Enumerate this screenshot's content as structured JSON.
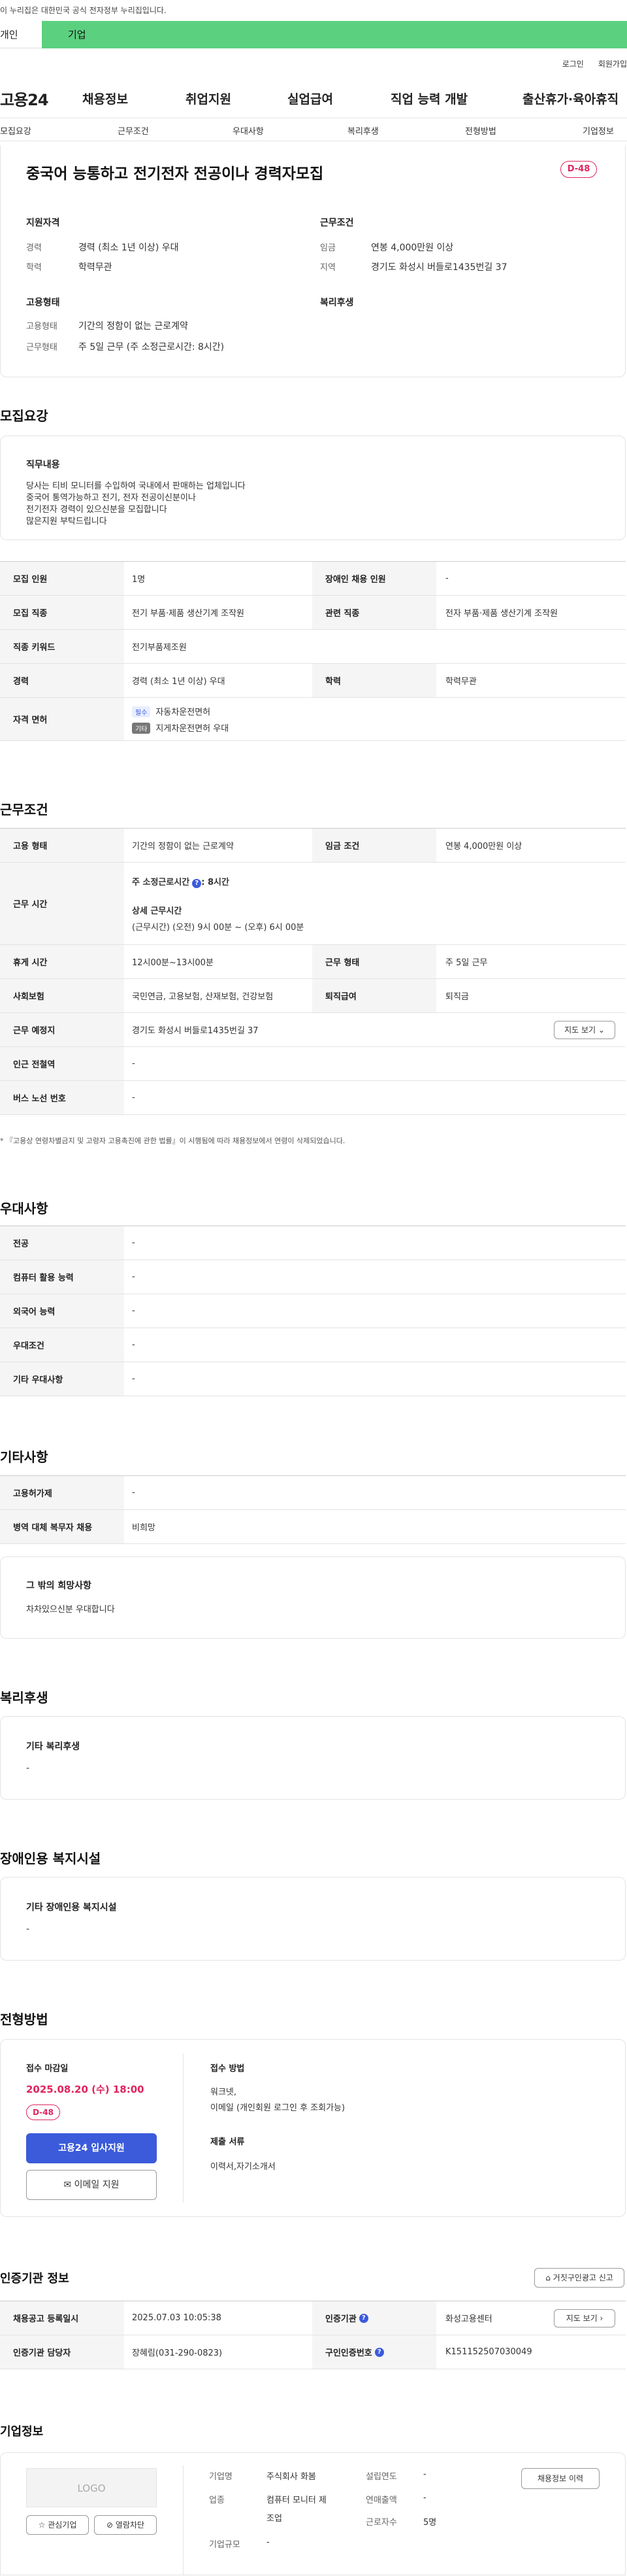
{
  "banner": {
    "text": "이 누리집은 대한민국 공식 전자정부 누리집입니다."
  },
  "tabs": {
    "personal": "개인",
    "company": "기업"
  },
  "util": {
    "login": "로그인",
    "signup": "회원가입"
  },
  "gnb": {
    "logo": "고용24",
    "items": [
      "채용정보",
      "취업지원",
      "실업급여",
      "직업 능력 개발",
      "출산휴가·육아휴직"
    ]
  },
  "subnav": [
    "모집요강",
    "근무조건",
    "우대사항",
    "복리후생",
    "전형방법",
    "기업정보"
  ],
  "summary": {
    "title": "중국어 능통하고 전기전자 전공이나 경력자모집",
    "dday": "D-48",
    "qual": {
      "heading": "지원자격",
      "career_k": "경력",
      "career_v": "경력 (최소 1년 이상) 우대",
      "edu_k": "학력",
      "edu_v": "학력무관"
    },
    "cond": {
      "heading": "근무조건",
      "wage_k": "임금",
      "wage_v": "연봉 4,000만원 이상",
      "loc_k": "지역",
      "loc_v": "경기도 화성시 버들로1435번길 37"
    },
    "emp": {
      "heading": "고용형태",
      "type_k": "고용형태",
      "type_v": "기간의 정함이 없는 근로계약",
      "work_k": "근무형태",
      "work_v": "주 5일 근무 (주 소정근로시간: 8시간)"
    },
    "welfare": {
      "heading": "복리후생"
    }
  },
  "recruit": {
    "title": "모집요강",
    "job_heading": "직무내용",
    "job_lines": [
      "당사는 티비 모니터를 수입하여 국내에서 판매하는 업체입니다",
      "중국어 통역가능하고 전기, 전자 전공이신분이나",
      "전기전자 경력이 있으신분을 모집합니다",
      "많은지원 부탁드립니다"
    ],
    "rows": [
      {
        "k1": "모집 인원",
        "v1": "1명",
        "k2": "장애인 채용 인원",
        "v2": "-"
      },
      {
        "k1": "모집 직종",
        "v1": "전기 부품·제품 생산기계 조작원",
        "k2": "관련 직종",
        "v2": "전자 부품·제품 생산기계 조작원"
      },
      {
        "k1": "직종 키워드",
        "v1": "전기부품제조원"
      },
      {
        "k1": "경력",
        "v1": "경력 (최소 1년 이상) 우대",
        "k2": "학력",
        "v2": "학력무관"
      }
    ],
    "license_k": "자격 면허",
    "license_tag1": "필수",
    "license_v1": "자동차운전면허",
    "license_tag2": "기타",
    "license_v2": "지게차운전면허 우대"
  },
  "work": {
    "title": "근무조건",
    "type_k": "고용 형태",
    "type_v": "기간의 정함이 없는 근로계약",
    "wage_k": "임금 조건",
    "wage_v": "연봉 4,000만원 이상",
    "time_k": "근무 시간",
    "time_main": "주 소정근로시간",
    "time_main_v": ": 8시간",
    "time_detail_h": "상세 근무시간",
    "time_detail_v": "(근무시간) (오전) 9시 00분 ~ (오후) 6시 00분",
    "rest_k": "휴게 시간",
    "rest_v": "12시00분~13시00분",
    "form_k": "근무 형태",
    "form_v": "주 5일 근무",
    "ins_k": "사회보험",
    "ins_v": "국민연금, 고용보험, 산재보험, 건강보험",
    "ret_k": "퇴직급여",
    "ret_v": "퇴직금",
    "place_k": "근무 예정지",
    "place_v": "경기도 화성시 버들로1435번길 37",
    "map_btn": "지도 보기",
    "station_k": "인근 전철역",
    "station_v": "-",
    "bus_k": "버스 노선 번호",
    "bus_v": "-",
    "note": "* 『고용상 연령차별금지 및 고령자 고용촉진에 관한 법률』이 시행됨에 따라 채용정보에서 연령이 삭제되었습니다."
  },
  "pref": {
    "title": "우대사항",
    "rows": [
      {
        "k": "전공",
        "v": "-"
      },
      {
        "k": "컴퓨터 활용 능력",
        "v": "-"
      },
      {
        "k": "외국어 능력",
        "v": "-"
      },
      {
        "k": "우대조건",
        "v": "-"
      },
      {
        "k": "기타 우대사항",
        "v": "-"
      }
    ]
  },
  "etc": {
    "title": "기타사항",
    "rows": [
      {
        "k": "고용허가제",
        "v": "-"
      },
      {
        "k": "병역 대체 복무자 채용",
        "v": "비희망"
      }
    ],
    "wish_h": "그 밖의 희망사항",
    "wish_v": "차차있으신분 우대합니다"
  },
  "welfare": {
    "title": "복리후생",
    "h": "기타 복리후생",
    "v": "-"
  },
  "disabled": {
    "title": "장애인용 복지시설",
    "h": "기타 장애인용 복지시설",
    "v": "-"
  },
  "screen": {
    "title": "전형방법",
    "deadline_h": "접수 마감일",
    "deadline_v": "2025.08.20 (수) 18:00",
    "dday": "D-48",
    "apply_btn": "고용24 입사지원",
    "email_btn": "이메일 지원",
    "method_h": "접수 방법",
    "method_v1": "워크넷,",
    "method_v2": "이메일 (개인회원 로그인 후 조회가능)",
    "docs_h": "제출 서류",
    "docs_v": "이력서,자기소개서"
  },
  "cert": {
    "title": "인증기관 정보",
    "report_btn": "거짓구인광고 신고",
    "reg_k": "채용공고 등록일시",
    "reg_v": "2025.07.03 10:05:38",
    "org_k": "인증기관",
    "org_v": "화성고용센터",
    "map_btn": "지도 보기",
    "staff_k": "인증기관 담당자",
    "staff_v": "장혜림(031-290-0823)",
    "no_k": "구인인증번호",
    "no_v": "K151152507030049"
  },
  "company": {
    "title": "기업정보",
    "logo": "LOGO",
    "fav_btn": "관심기업",
    "block_btn": "열람차단",
    "history_btn": "채용정보 이력",
    "name_k": "기업명",
    "name_v": "주식회사 화봄",
    "ind_k": "업종",
    "ind_v1": "컴퓨터 모니터 제",
    "ind_v2": "조업",
    "size_k": "기업규모",
    "size_v": "-",
    "year_k": "설립연도",
    "year_v": "-",
    "sales_k": "연매출액",
    "sales_v": "-",
    "emp_k": "근로자수",
    "emp_v": "5명"
  },
  "colors": {
    "accent": "#5bd07e",
    "dday": "#e0245e",
    "deadline": "#e0245e",
    "primary_btn": "#3b5bdb"
  }
}
